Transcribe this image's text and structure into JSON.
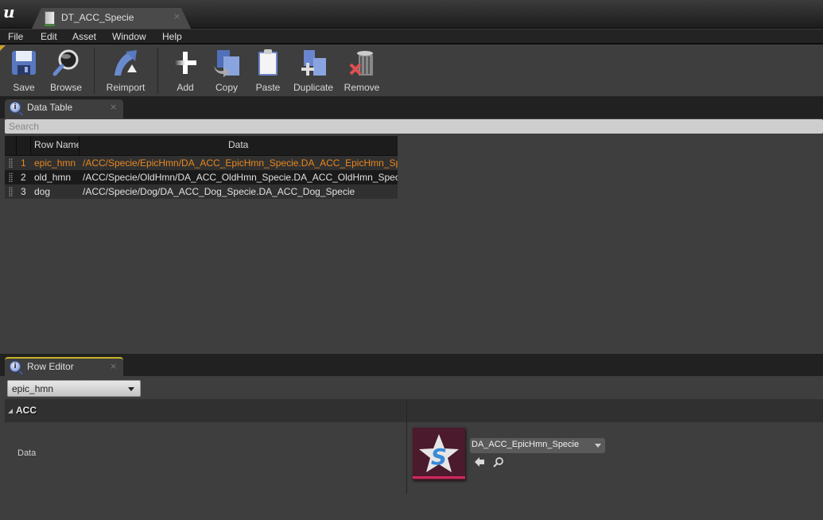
{
  "window": {
    "document_tab": "DT_ACC_Specie",
    "close_glyph": "×"
  },
  "menu": [
    "File",
    "Edit",
    "Asset",
    "Window",
    "Help"
  ],
  "toolbar": {
    "buttons": [
      {
        "label": "Save",
        "icon": "floppy-disk-icon"
      },
      {
        "label": "Browse",
        "icon": "magnifier-icon"
      },
      {
        "label": "Reimport",
        "icon": "reimport-arrow-icon"
      },
      {
        "label": "Add",
        "icon": "plus-icon"
      },
      {
        "label": "Copy",
        "icon": "copy-icon"
      },
      {
        "label": "Paste",
        "icon": "clipboard-icon"
      },
      {
        "label": "Duplicate",
        "icon": "duplicate-icon"
      },
      {
        "label": "Remove",
        "icon": "trash-remove-icon"
      }
    ]
  },
  "data_table_panel": {
    "tab_label": "Data Table",
    "search_placeholder": "Search",
    "columns": {
      "row_name": "Row Name",
      "data": "Data"
    },
    "rows": [
      {
        "num": "1",
        "name": "epic_hmn",
        "data": "/ACC/Specie/EpicHmn/DA_ACC_EpicHmn_Specie.DA_ACC_EpicHmn_Specie",
        "selected": true
      },
      {
        "num": "2",
        "name": "old_hmn",
        "data": "/ACC/Specie/OldHmn/DA_ACC_OldHmn_Specie.DA_ACC_OldHmn_Specie",
        "selected": false
      },
      {
        "num": "3",
        "name": "dog",
        "data": "/ACC/Specie/Dog/DA_ACC_Dog_Specie.DA_ACC_Dog_Specie",
        "selected": false
      }
    ]
  },
  "row_editor_panel": {
    "tab_label": "Row Editor",
    "selected_row": "epic_hmn",
    "category": "ACC",
    "property_label": "Data",
    "asset_value": "DA_ACC_EpicHmn_Specie",
    "thumbnail_letter": "S"
  },
  "colors": {
    "selected_text": "#e8871e",
    "accent_tab": "#c8b42a",
    "thumbnail_bg": "#4b1a2c",
    "thumbnail_bar": "#d0285e"
  }
}
